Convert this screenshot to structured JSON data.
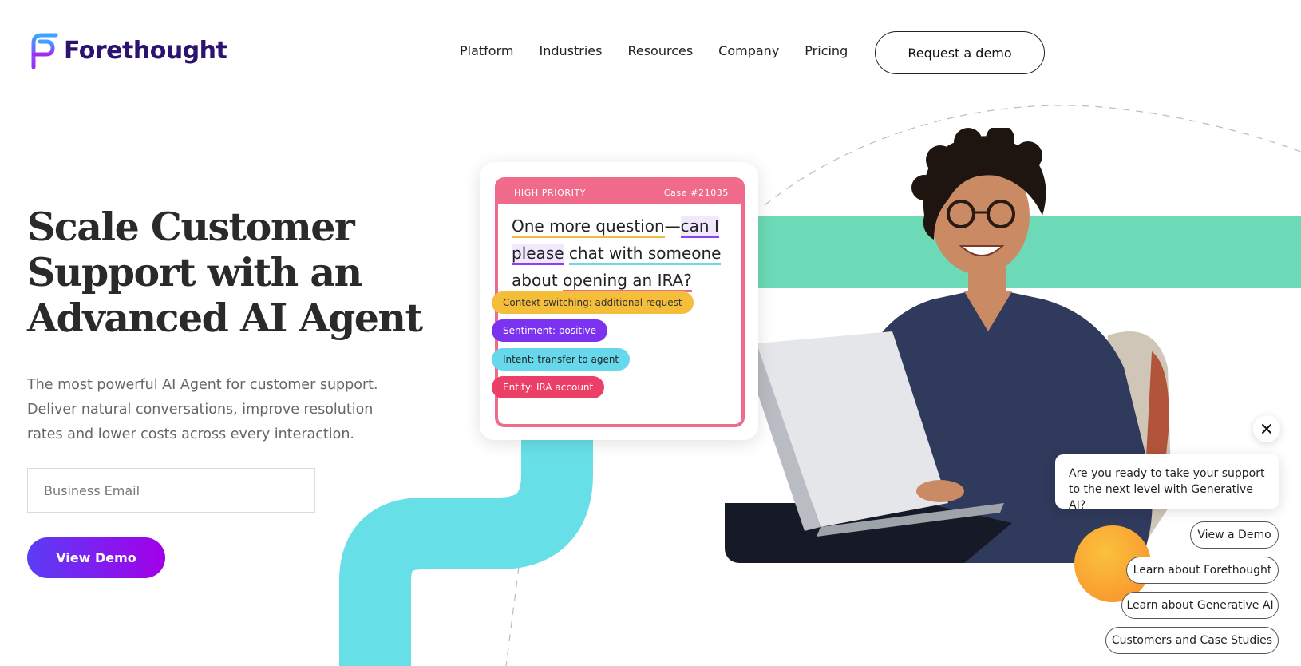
{
  "header": {
    "brand": "Forethought",
    "nav": [
      "Platform",
      "Industries",
      "Resources",
      "Company",
      "Pricing"
    ],
    "cta_label": "Request a demo"
  },
  "hero": {
    "title_lines": [
      "Scale Customer",
      "Support with an",
      "Advanced AI Agent"
    ],
    "subtitle_lines": [
      "The most powerful AI Agent for customer support.",
      "Deliver natural conversations, improve resolution",
      "rates and lower costs across every interaction."
    ],
    "email_placeholder": "Business Email",
    "demo_button_label": "View Demo"
  },
  "case_card": {
    "priority": "HIGH PRIORITY",
    "case_id": "Case #21035",
    "message": {
      "part1": "One more question",
      "dash": "—",
      "part2": "can I",
      "part3": "please",
      "part4": "chat with someone",
      "part5": "about",
      "part6": "opening an IRA?"
    },
    "tags": [
      "Context switching: additional request",
      "Sentiment: positive",
      "Intent: transfer to agent",
      "Entity: IRA account"
    ]
  },
  "chat_widget": {
    "prompt": "Are you ready to take your support to the next level with Generative AI?",
    "options": [
      "View a Demo",
      "Learn about Forethought",
      "Learn about Generative AI",
      "Customers and Case Studies"
    ]
  },
  "colors": {
    "brand_dark": "#2b1470",
    "gradient_start": "#5b3df5",
    "gradient_end": "#a200e8",
    "priority_pink": "#ef6a8b",
    "mint": "#6cdab7",
    "cyan": "#67dfe6",
    "orb_orange": "#f9a232"
  },
  "icons": [
    "forethought-logo-icon",
    "close-icon"
  ]
}
